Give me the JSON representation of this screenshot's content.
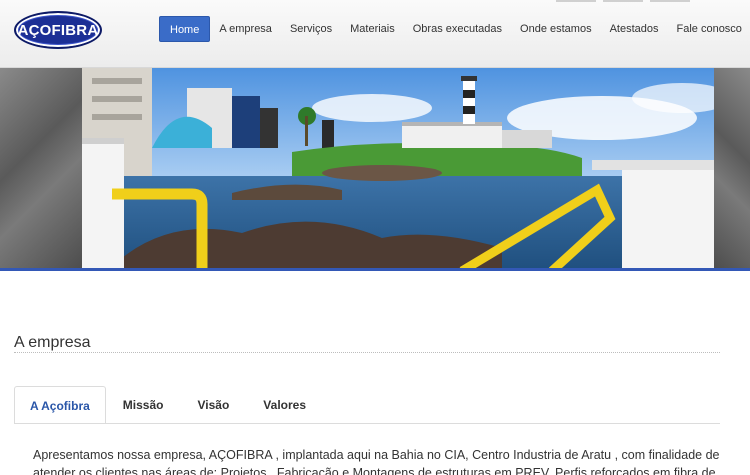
{
  "brand": {
    "logo_text": "AÇOFIBRA",
    "logo_color": "#1c2f95"
  },
  "nav": {
    "items": [
      {
        "label": "Home",
        "active": true
      },
      {
        "label": "A empresa"
      },
      {
        "label": "Serviços"
      },
      {
        "label": "Materiais"
      },
      {
        "label": "Obras executadas"
      },
      {
        "label": "Onde estamos"
      },
      {
        "label": "Atestados"
      },
      {
        "label": "Fale conosco"
      }
    ],
    "accent": "#3a6cc8"
  },
  "section": {
    "title": "A empresa",
    "tabs": [
      {
        "label": "A Açofibra",
        "active": true
      },
      {
        "label": "Missão"
      },
      {
        "label": "Visão"
      },
      {
        "label": "Valores"
      }
    ],
    "body": "Apresentamos nossa empresa, AÇOFIBRA , implantada aqui na Bahia no CIA, Centro Industria de Aratu , com finalidade de atender os clientes nas áreas de: Projetos , Fabricação e Montagens de estruturas em PREV, Perfis reforçados em fibra de"
  }
}
